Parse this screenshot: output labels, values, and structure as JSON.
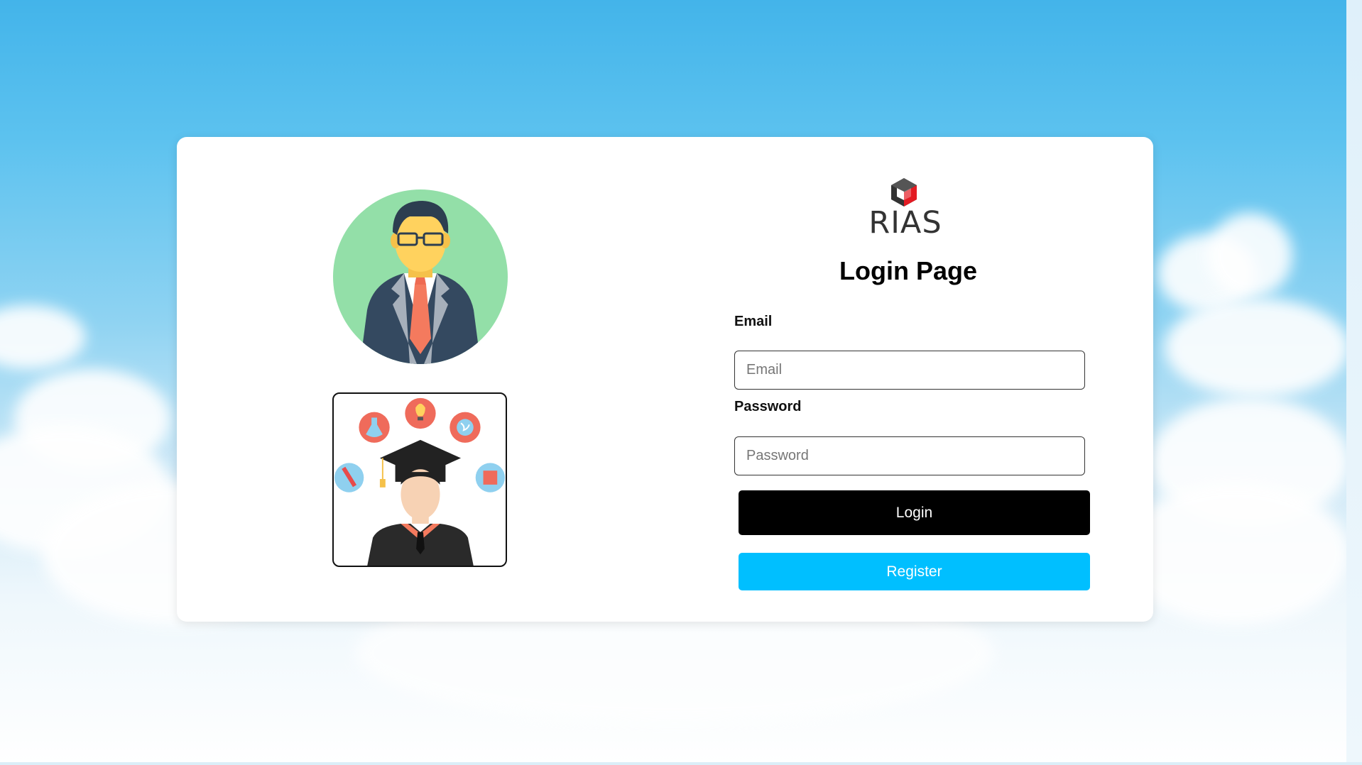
{
  "brand": {
    "logo_text": "RIAS",
    "icon": "rias-cube-logo-icon"
  },
  "page": {
    "title": "Login Page"
  },
  "illustrations": {
    "teacher": "teacher-avatar-icon",
    "student": "graduate-student-icon"
  },
  "form": {
    "email_label": "Email",
    "email_placeholder": "Email",
    "email_value": "",
    "password_label": "Password",
    "password_placeholder": "Password",
    "password_value": "",
    "login_label": "Login",
    "register_label": "Register"
  },
  "colors": {
    "login_button": "#000000",
    "register_button": "#00bfff",
    "logo_accent": "#e31b23",
    "logo_dark": "#333333"
  }
}
